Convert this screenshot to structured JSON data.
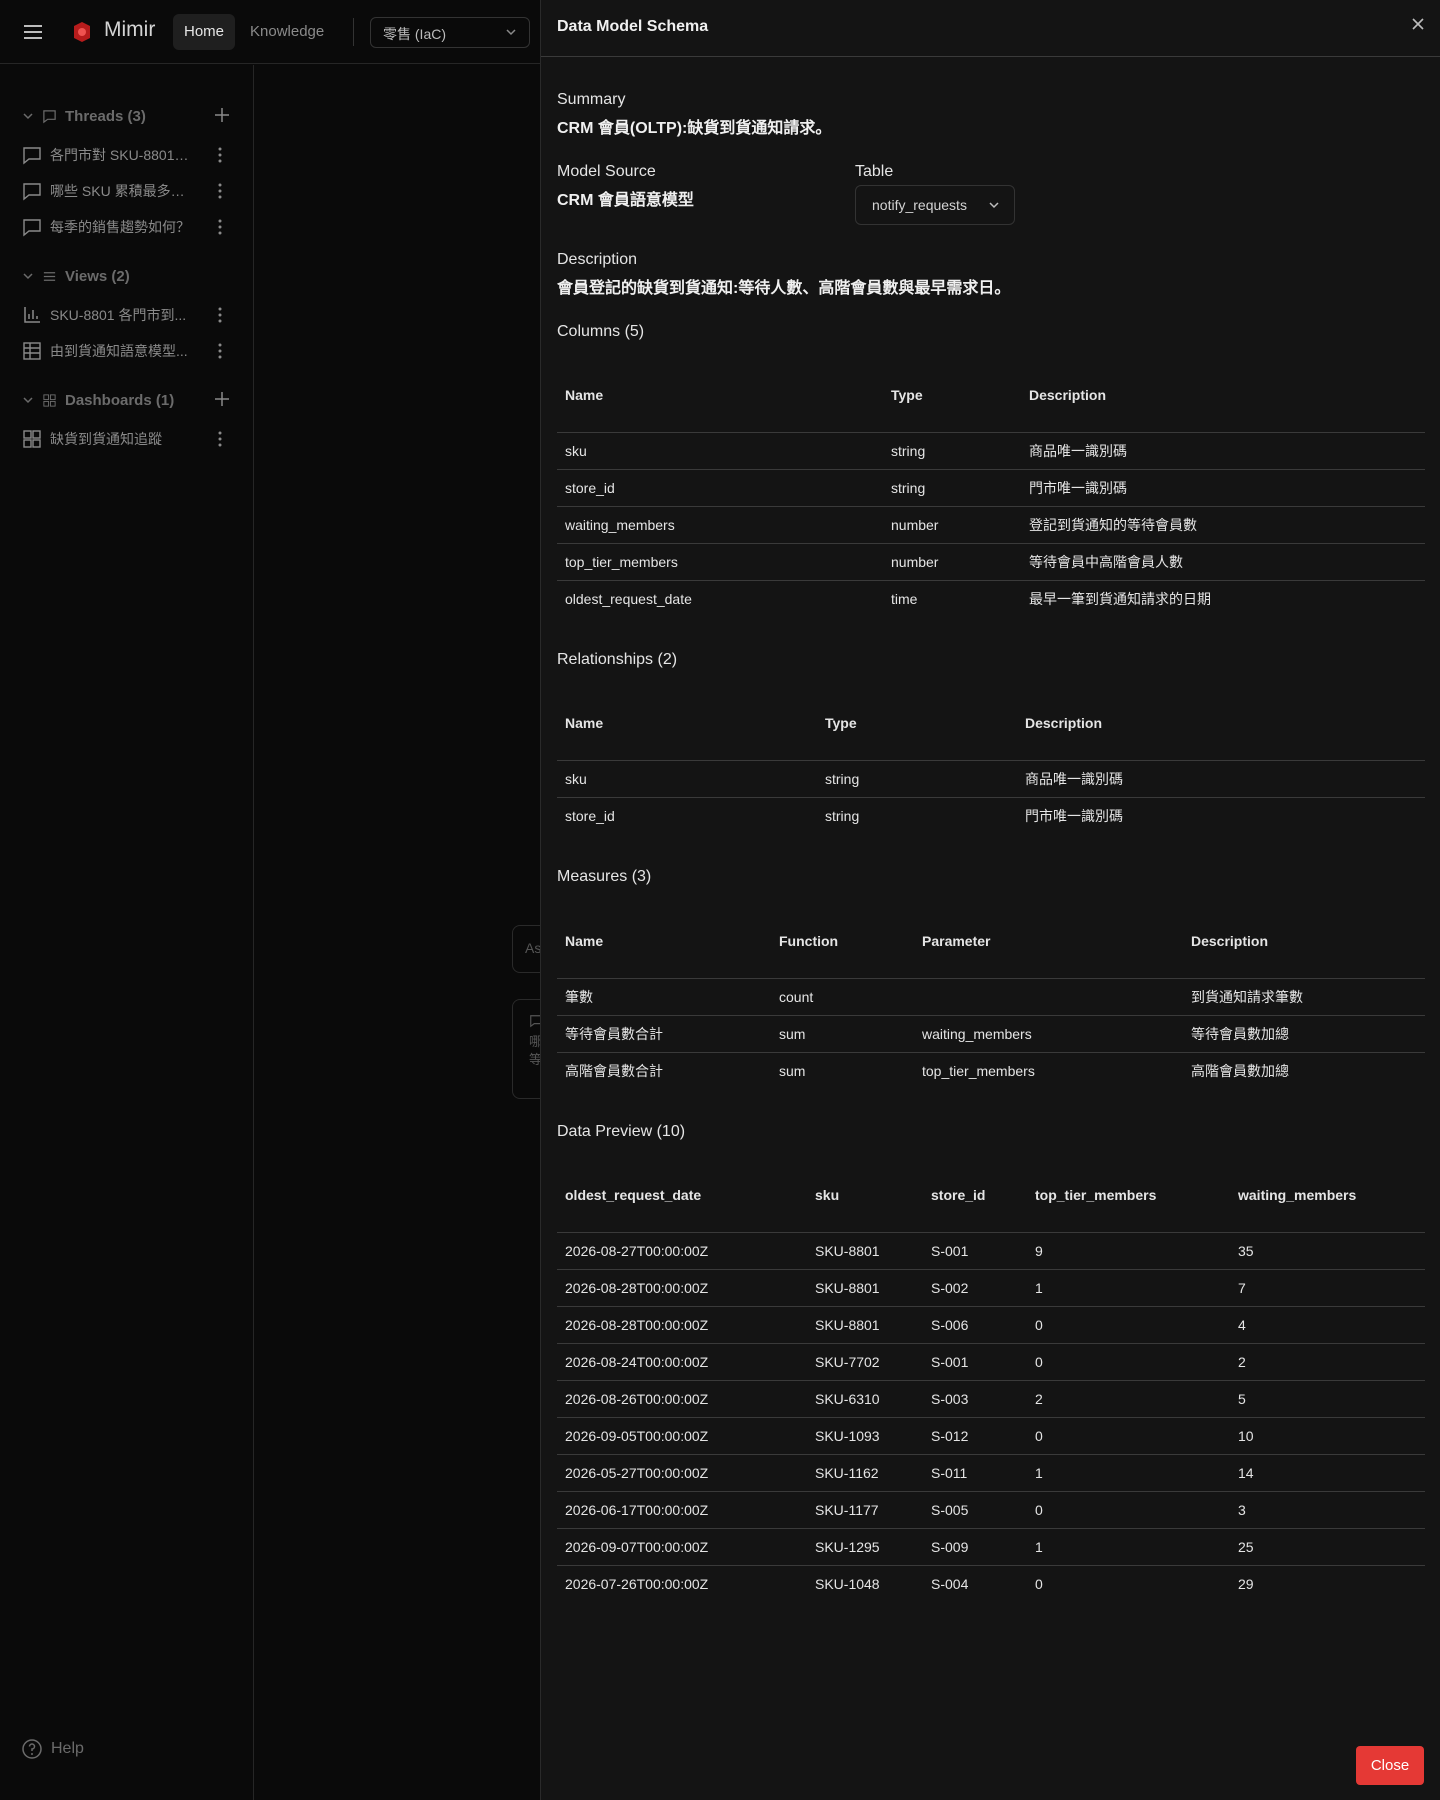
{
  "app": {
    "name": "Mimir",
    "nav": [
      "Home",
      "Knowledge"
    ],
    "workspace": "零售 (IaC)"
  },
  "sidebar": {
    "threads_title": "Threads (3)",
    "threads": [
      "各門市對 SKU-8801 ...",
      "哪些 SKU 累積最多到...",
      "每季的銷售趨勢如何？"
    ],
    "views_title": "Views (2)",
    "views": [
      "SKU-8801 各門市到...",
      "由到貨通知語意模型..."
    ],
    "dashboards_title": "Dashboards (1)",
    "dashboards": [
      "缺貨到貨通知追蹤"
    ],
    "help": "Help"
  },
  "background": {
    "input_placeholder": "As",
    "card_lines": [
      "哪",
      "等"
    ]
  },
  "panel": {
    "title": "Data Model Schema",
    "summary_label": "Summary",
    "summary_value": "CRM 會員(OLTP):缺貨到貨通知請求。",
    "model_source_label": "Model Source",
    "model_source_value": "CRM 會員語意模型",
    "table_label": "Table",
    "table_value": "notify_requests",
    "description_label": "Description",
    "description_value": "會員登記的缺貨到貨通知:等待人數、高階會員數與最早需求日。",
    "close_button": "Close"
  },
  "columns": {
    "title": "Columns (5)",
    "headers": [
      "Name",
      "Type",
      "Description"
    ],
    "rows": [
      [
        "sku",
        "string",
        "商品唯一識別碼"
      ],
      [
        "store_id",
        "string",
        "門市唯一識別碼"
      ],
      [
        "waiting_members",
        "number",
        "登記到貨通知的等待會員數"
      ],
      [
        "top_tier_members",
        "number",
        "等待會員中高階會員人數"
      ],
      [
        "oldest_request_date",
        "time",
        "最早一筆到貨通知請求的日期"
      ]
    ]
  },
  "relationships": {
    "title": "Relationships (2)",
    "headers": [
      "Name",
      "Type",
      "Description"
    ],
    "rows": [
      [
        "sku",
        "string",
        "商品唯一識別碼"
      ],
      [
        "store_id",
        "string",
        "門市唯一識別碼"
      ]
    ]
  },
  "measures": {
    "title": "Measures (3)",
    "headers": [
      "Name",
      "Function",
      "Parameter",
      "Description"
    ],
    "rows": [
      [
        "筆數",
        "count",
        "",
        "到貨通知請求筆數"
      ],
      [
        "等待會員數合計",
        "sum",
        "waiting_members",
        "等待會員數加總"
      ],
      [
        "高階會員數合計",
        "sum",
        "top_tier_members",
        "高階會員數加總"
      ]
    ]
  },
  "preview": {
    "title": "Data Preview (10)",
    "headers": [
      "oldest_request_date",
      "sku",
      "store_id",
      "top_tier_members",
      "waiting_members"
    ],
    "rows": [
      [
        "2026-08-27T00:00:00Z",
        "SKU-8801",
        "S-001",
        "9",
        "35"
      ],
      [
        "2026-08-28T00:00:00Z",
        "SKU-8801",
        "S-002",
        "1",
        "7"
      ],
      [
        "2026-08-28T00:00:00Z",
        "SKU-8801",
        "S-006",
        "0",
        "4"
      ],
      [
        "2026-08-24T00:00:00Z",
        "SKU-7702",
        "S-001",
        "0",
        "2"
      ],
      [
        "2026-08-26T00:00:00Z",
        "SKU-6310",
        "S-003",
        "2",
        "5"
      ],
      [
        "2026-09-05T00:00:00Z",
        "SKU-1093",
        "S-012",
        "0",
        "10"
      ],
      [
        "2026-05-27T00:00:00Z",
        "SKU-1162",
        "S-011",
        "1",
        "14"
      ],
      [
        "2026-06-17T00:00:00Z",
        "SKU-1177",
        "S-005",
        "0",
        "3"
      ],
      [
        "2026-09-07T00:00:00Z",
        "SKU-1295",
        "S-009",
        "1",
        "25"
      ],
      [
        "2026-07-26T00:00:00Z",
        "SKU-1048",
        "S-004",
        "0",
        "29"
      ]
    ]
  },
  "colors": {
    "accent_close": "#e53935",
    "logo": "#c62828",
    "background": "#0a0a0a",
    "panel": "#141414"
  },
  "icons": [
    "menu-icon",
    "logo-icon",
    "chevron-down-icon",
    "chat-icon",
    "list-icon",
    "dashboard-icon",
    "chart-icon",
    "table-icon",
    "plus-icon",
    "kebab-icon",
    "help-icon",
    "close-icon"
  ]
}
